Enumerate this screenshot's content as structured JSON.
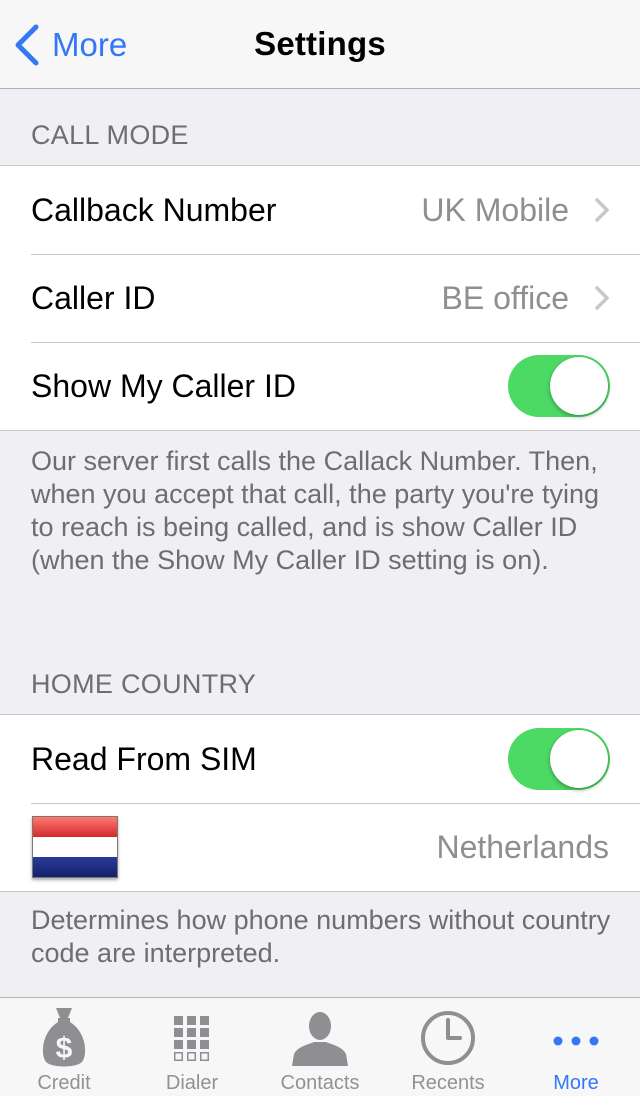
{
  "nav": {
    "back_label": "More",
    "title": "Settings"
  },
  "call_mode": {
    "header": "CALL MODE",
    "callback": {
      "label": "Callback Number",
      "value": "UK Mobile"
    },
    "caller_id": {
      "label": "Caller ID",
      "value": "BE office"
    },
    "show_caller_id": {
      "label": "Show My Caller ID",
      "on": true
    },
    "footer": "Our server first calls the Callack Number. Then, when you accept that call, the party you're tying to reach is being called, and is show Caller ID (when the Show My Caller ID setting is on)."
  },
  "home_country": {
    "header": "HOME COUNTRY",
    "read_from_sim": {
      "label": "Read From SIM",
      "on": true
    },
    "country": {
      "value": "Netherlands",
      "flag": "netherlands-flag"
    },
    "footer": "Determines how phone numbers without country code are interpreted."
  },
  "tabs": [
    {
      "label": "Credit",
      "icon": "money-bag-icon"
    },
    {
      "label": "Dialer",
      "icon": "keypad-icon"
    },
    {
      "label": "Contacts",
      "icon": "person-icon"
    },
    {
      "label": "Recents",
      "icon": "clock-icon"
    },
    {
      "label": "More",
      "icon": "more-dots-icon",
      "active": true
    }
  ],
  "colors": {
    "accent": "#3478f6",
    "toggle_on": "#4cd964",
    "background": "#efeff4",
    "secondary_text": "#8e8e93"
  }
}
